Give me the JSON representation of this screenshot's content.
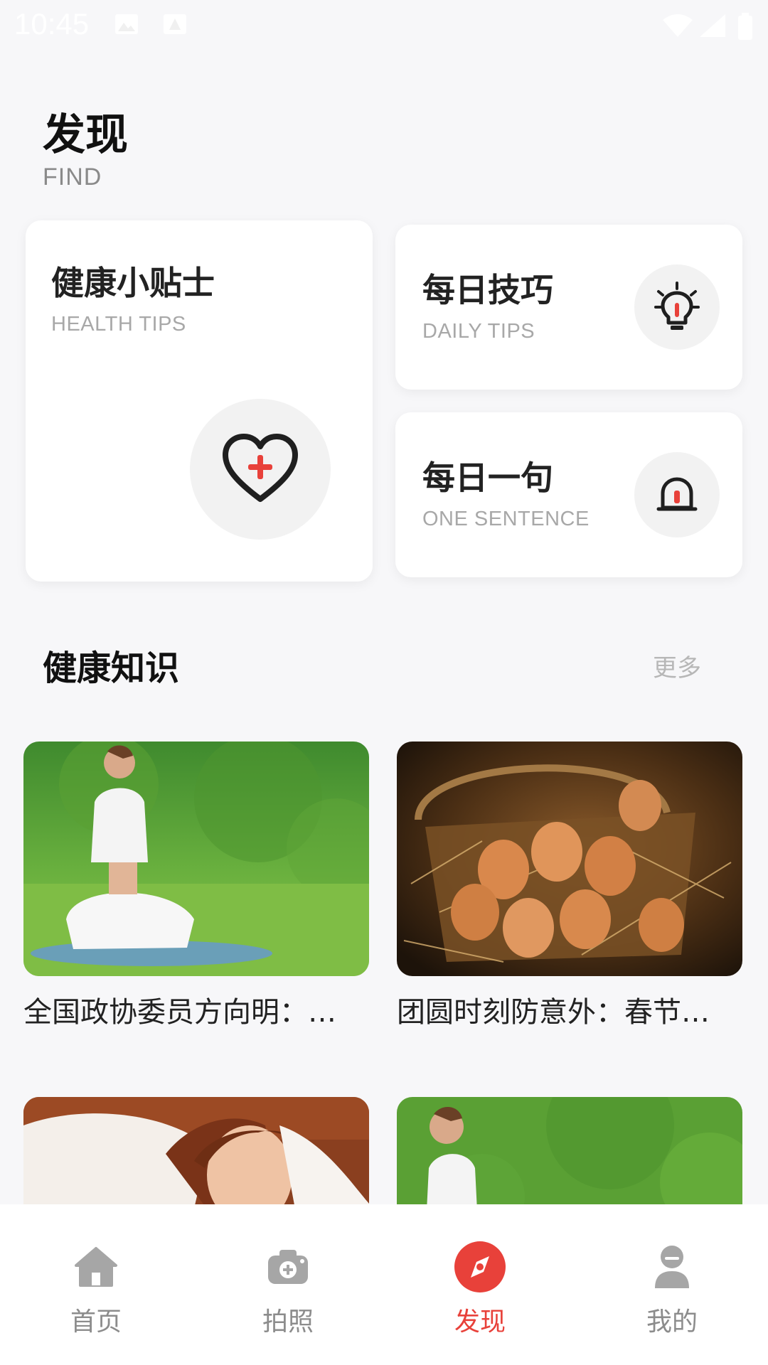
{
  "status_bar": {
    "time": "10:45"
  },
  "header": {
    "title": "发现",
    "subtitle": "FIND"
  },
  "cards": {
    "health_tips": {
      "title": "健康小贴士",
      "subtitle": "HEALTH TIPS",
      "icon": "heart-plus-icon"
    },
    "daily_tips": {
      "title": "每日技巧",
      "subtitle": "DAILY TIPS",
      "icon": "lightbulb-icon"
    },
    "one_sentence": {
      "title": "每日一句",
      "subtitle": "ONE SENTENCE",
      "icon": "bell-icon"
    }
  },
  "section": {
    "title": "健康知识",
    "more": "更多"
  },
  "articles": [
    {
      "title": "全国政协委员方向明：…",
      "image": "woman-yoga-on-grass"
    },
    {
      "title": "团圆时刻防意外：春节…",
      "image": "eggs-in-basket"
    },
    {
      "title": "",
      "image": "woman-sleeping"
    },
    {
      "title": "",
      "image": "woman-yoga-on-grass"
    }
  ],
  "bottom_nav": [
    {
      "label": "首页",
      "icon": "home-icon",
      "active": false
    },
    {
      "label": "拍照",
      "icon": "camera-icon",
      "active": false
    },
    {
      "label": "发现",
      "icon": "compass-icon",
      "active": true
    },
    {
      "label": "我的",
      "icon": "user-icon",
      "active": false
    }
  ],
  "colors": {
    "accent": "#e8413a",
    "background": "#f7f7f9",
    "card": "#ffffff",
    "muted": "#a8a8a8"
  }
}
